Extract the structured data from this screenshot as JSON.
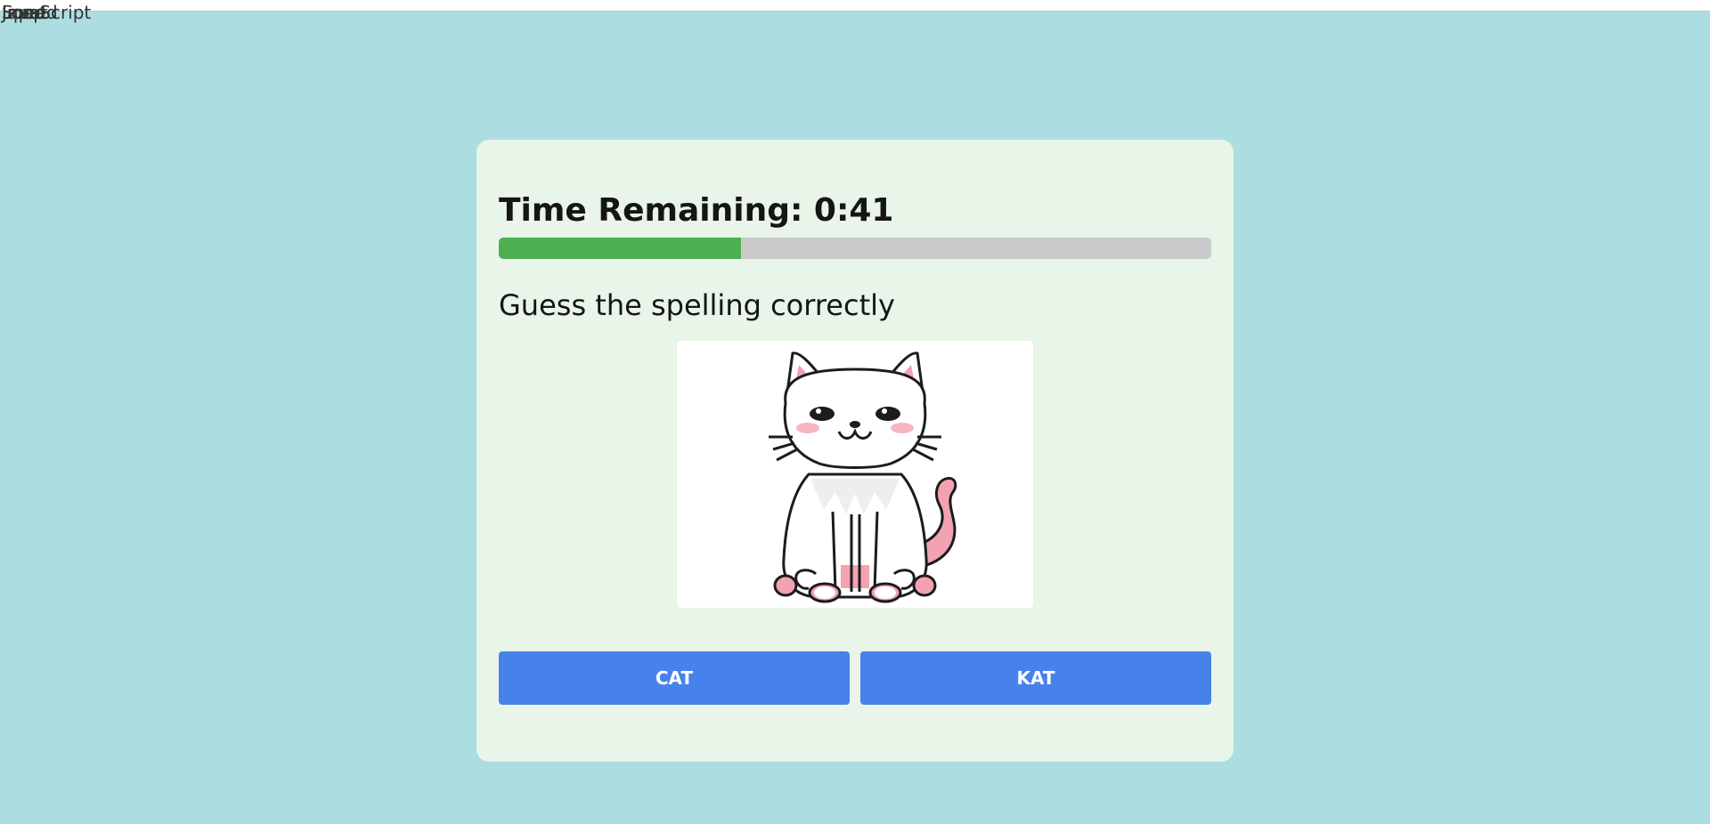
{
  "overlapping_header": {
    "texts": [
      "JavaScript",
      "Input",
      "Loop",
      "Loop",
      "Speed"
    ]
  },
  "game": {
    "timer_label": "Time Remaining: 0:41",
    "time_progress": 0.34,
    "prompt": "Guess the spelling correctly",
    "picture_subject": "cat-illustration",
    "answers": [
      "CAT",
      "KAT"
    ]
  },
  "colors": {
    "page_background": "#acdde0",
    "card_background": "#e8f5e8",
    "progress_fill": "#4caf50",
    "progress_track": "#cacaca",
    "button": "#4682ea"
  }
}
